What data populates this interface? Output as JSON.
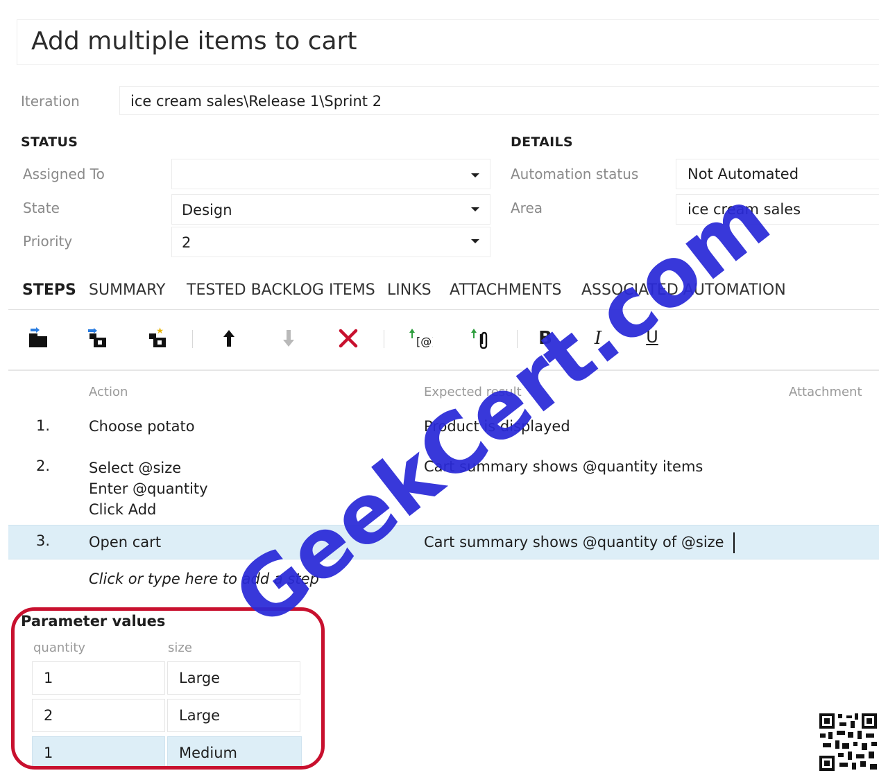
{
  "title": "Add multiple items to cart",
  "iteration": {
    "label": "Iteration",
    "value": "ice cream sales\\Release 1\\Sprint 2"
  },
  "status": {
    "heading": "STATUS",
    "assigned_to": {
      "label": "Assigned To",
      "value": ""
    },
    "state": {
      "label": "State",
      "value": "Design"
    },
    "priority": {
      "label": "Priority",
      "value": "2"
    }
  },
  "details": {
    "heading": "DETAILS",
    "automation_status": {
      "label": "Automation status",
      "value": "Not Automated"
    },
    "area": {
      "label": "Area",
      "value": "ice cream sales"
    }
  },
  "tabs": [
    {
      "label": "STEPS",
      "active": true
    },
    {
      "label": "SUMMARY",
      "active": false
    },
    {
      "label": "TESTED BACKLOG ITEMS",
      "active": false
    },
    {
      "label": "LINKS",
      "active": false
    },
    {
      "label": "ATTACHMENTS",
      "active": false
    },
    {
      "label": "ASSOCIATED AUTOMATION",
      "active": false
    }
  ],
  "toolbar": {
    "icons": [
      "insert-step-icon",
      "insert-shared-steps-icon",
      "create-shared-steps-icon",
      "move-up-icon",
      "move-down-icon",
      "delete-step-icon",
      "insert-parameter-icon",
      "add-attachment-icon",
      "bold-icon",
      "italic-icon",
      "underline-icon"
    ],
    "bold": "B",
    "italic": "I",
    "underline": "U"
  },
  "steps_grid": {
    "columns": {
      "action": "Action",
      "expected": "Expected result",
      "attachment": "Attachment"
    },
    "rows": [
      {
        "num": "1.",
        "action": [
          "Choose potato"
        ],
        "expected": "Product is displayed",
        "selected": false
      },
      {
        "num": "2.",
        "action": [
          "Select @size",
          "Enter @quantity",
          "Click Add"
        ],
        "expected": "Cart summary shows @quantity items",
        "selected": false
      },
      {
        "num": "3.",
        "action": [
          "Open cart"
        ],
        "expected": "Cart summary shows @quantity of @size",
        "selected": true
      }
    ],
    "add_step_placeholder": "Click or type here to add a step"
  },
  "parameters": {
    "heading": "Parameter values",
    "columns": [
      "quantity",
      "size"
    ],
    "rows": [
      {
        "quantity": "1",
        "size": "Large",
        "selected": false
      },
      {
        "quantity": "2",
        "size": "Large",
        "selected": false
      },
      {
        "quantity": "1",
        "size": "Medium",
        "selected": true
      }
    ]
  },
  "watermark": "GeekCert.com",
  "colors": {
    "selected_row": "#ddeef7",
    "highlight_ring": "#c8102e",
    "watermark": "#2a2ad8"
  }
}
